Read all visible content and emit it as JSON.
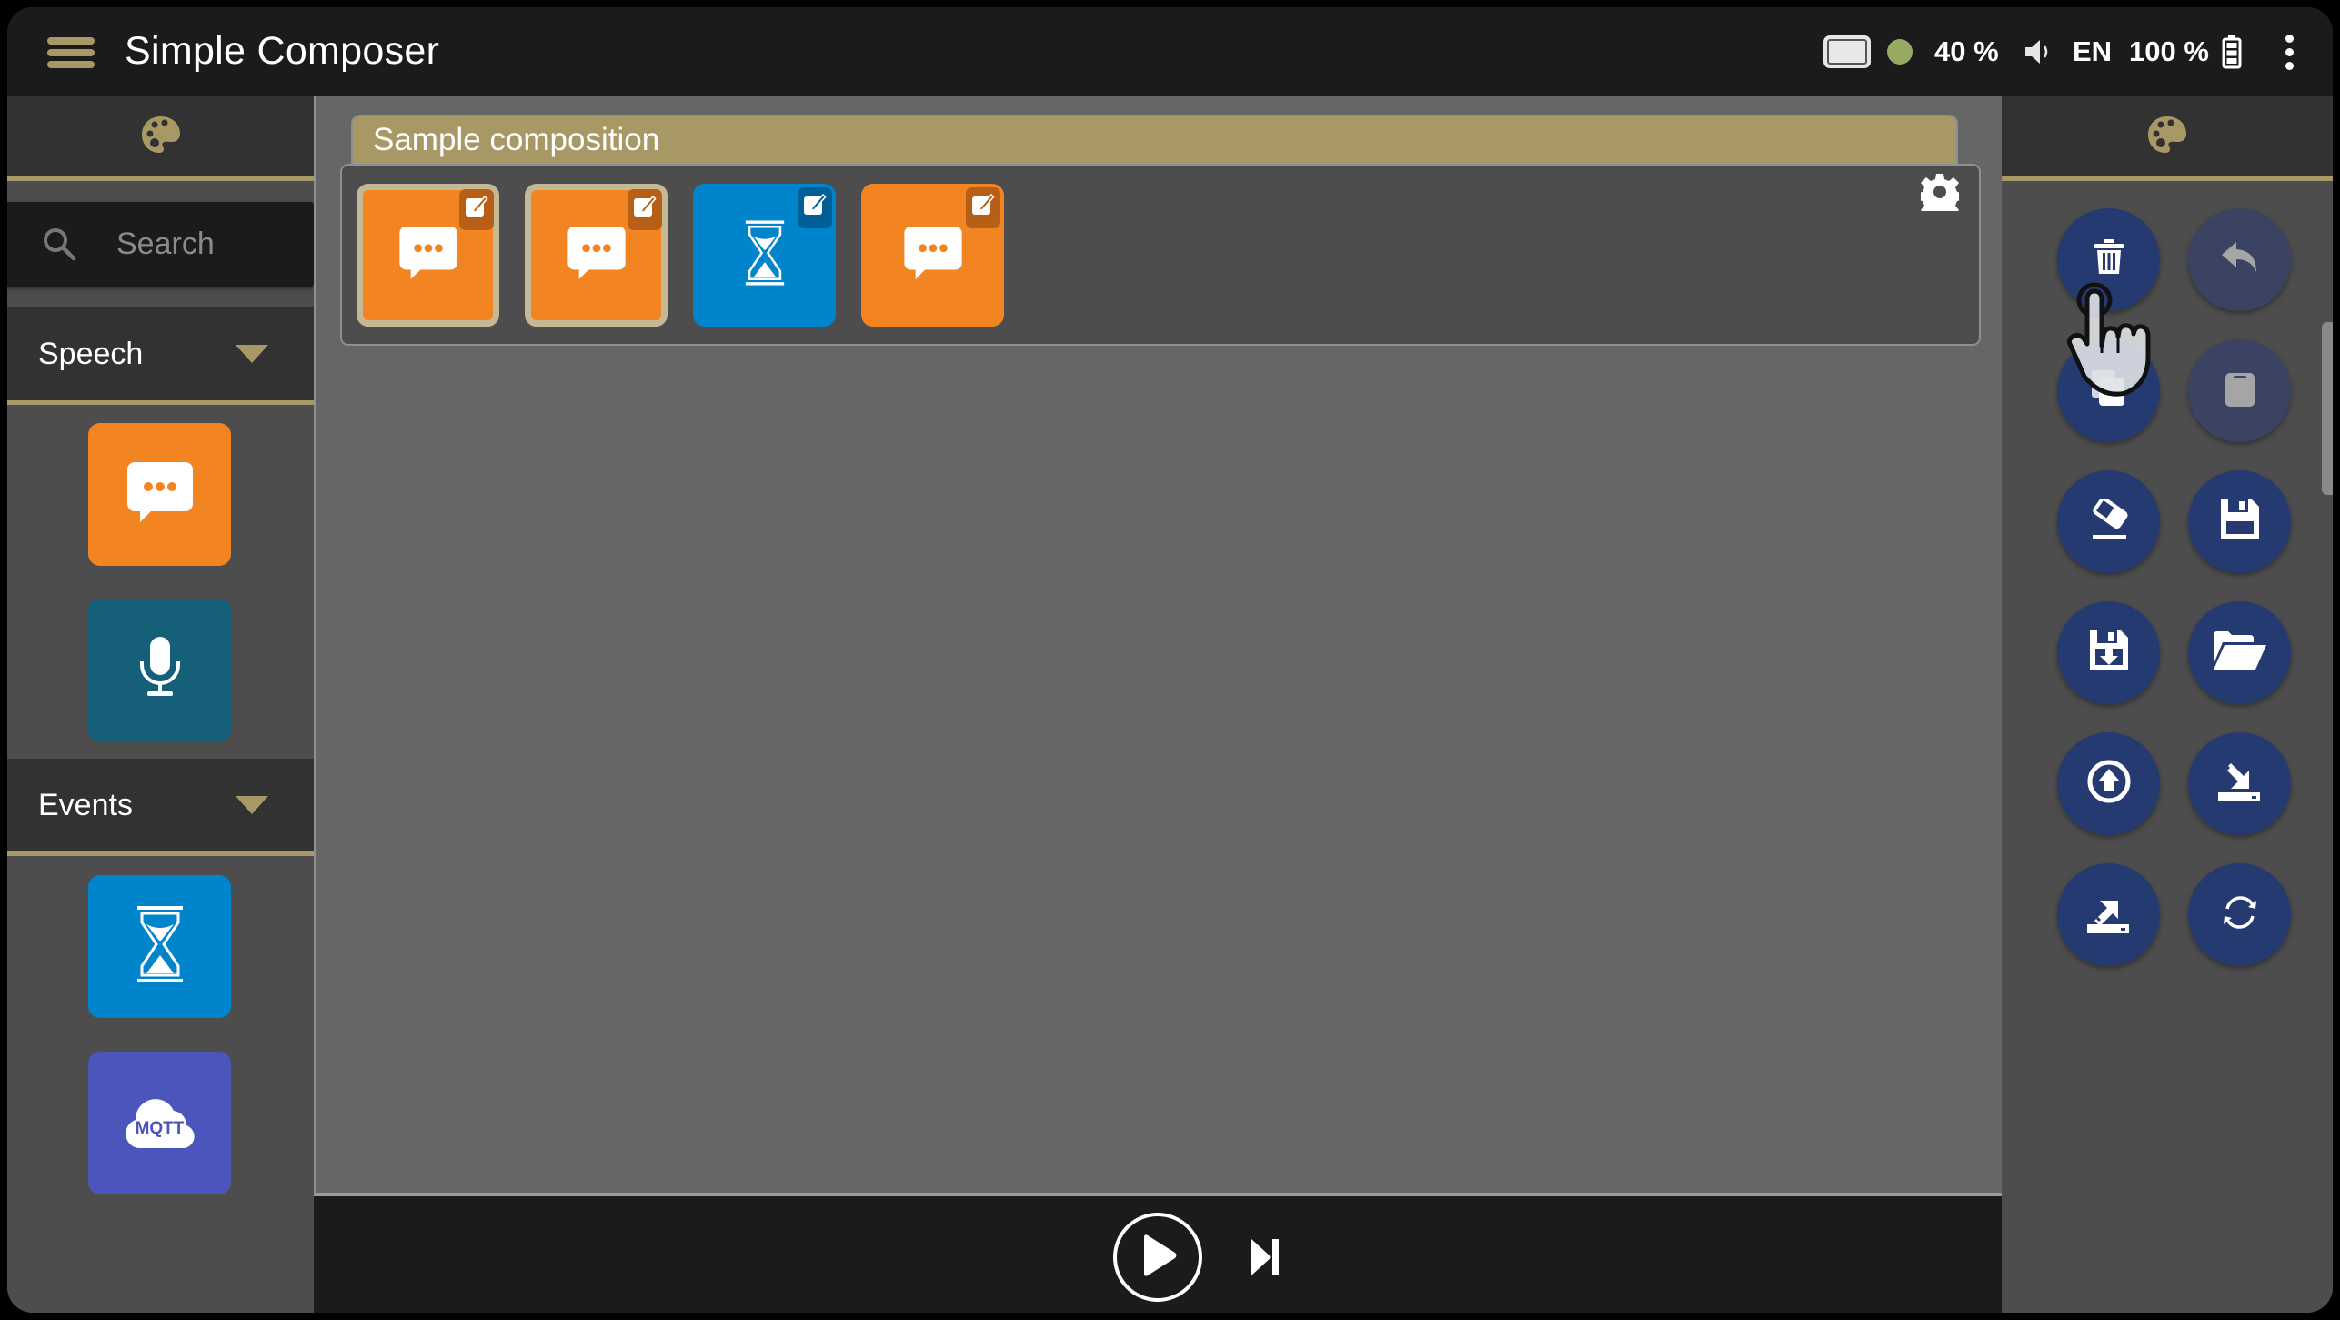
{
  "app": {
    "title": "Simple Composer",
    "menu_icon": "hamburger-menu-icon"
  },
  "status_bar": {
    "display_icon": "screen-icon",
    "connection_color": "#98a964",
    "volume_level": "40 %",
    "volume_icon": "speaker-icon",
    "language": "EN",
    "battery_level": "100 %",
    "battery_icon": "battery-full-icon",
    "more_icon": "kebab-menu-icon"
  },
  "left_sidebar": {
    "header_icon": "palette-icon",
    "search": {
      "placeholder": "Search",
      "value": ""
    },
    "categories": [
      {
        "label": "Speech",
        "expanded": true,
        "blocks": [
          {
            "name": "say",
            "icon": "speech-bubble-icon",
            "color": "#f28422"
          },
          {
            "name": "listen",
            "icon": "microphone-icon",
            "color": "#155f79"
          }
        ]
      },
      {
        "label": "Events",
        "expanded": true,
        "blocks": [
          {
            "name": "wait",
            "icon": "hourglass-icon",
            "color": "#0084cc"
          },
          {
            "name": "mqtt",
            "icon": "mqtt-cloud-icon",
            "color": "#4c55bc",
            "icon_text": "MQTT"
          }
        ]
      }
    ]
  },
  "composition": {
    "title": "Sample composition",
    "settings_icon": "gear-icon",
    "blocks": [
      {
        "icon": "speech-bubble-icon",
        "color": "#f28422",
        "badge_color": "#b85f17",
        "selected": true
      },
      {
        "icon": "speech-bubble-icon",
        "color": "#f28422",
        "badge_color": "#b85f17",
        "selected": true
      },
      {
        "icon": "hourglass-icon",
        "color": "#0084cc",
        "badge_color": "#005f96",
        "selected": false
      },
      {
        "icon": "speech-bubble-icon",
        "color": "#f28422",
        "badge_color": "#b85f17",
        "selected": false
      }
    ]
  },
  "playback": {
    "play_icon": "play-icon",
    "step_icon": "skip-next-icon"
  },
  "right_panel": {
    "header_icon": "palette-icon",
    "actions": [
      {
        "name": "delete",
        "icon": "trash-icon",
        "enabled": true
      },
      {
        "name": "undo",
        "icon": "undo-icon",
        "enabled": false
      },
      {
        "name": "copy",
        "icon": "copy-icon",
        "enabled": true
      },
      {
        "name": "paste",
        "icon": "clipboard-icon",
        "enabled": false
      },
      {
        "name": "clear",
        "icon": "eraser-icon",
        "enabled": true
      },
      {
        "name": "save",
        "icon": "floppy-icon",
        "enabled": true
      },
      {
        "name": "save-as",
        "icon": "floppy-download-icon",
        "enabled": true
      },
      {
        "name": "open",
        "icon": "folder-open-icon",
        "enabled": true
      },
      {
        "name": "upload",
        "icon": "upload-circle-icon",
        "enabled": true
      },
      {
        "name": "import",
        "icon": "import-tray-icon",
        "enabled": true
      },
      {
        "name": "export",
        "icon": "export-tray-icon",
        "enabled": true
      },
      {
        "name": "sync",
        "icon": "sync-icon",
        "enabled": true
      }
    ]
  },
  "colors": {
    "accent": "#a89865",
    "topbar": "#1b1b1b",
    "panel": "#4d4d4d",
    "canvas": "#666666",
    "action_button": "#263a72"
  }
}
